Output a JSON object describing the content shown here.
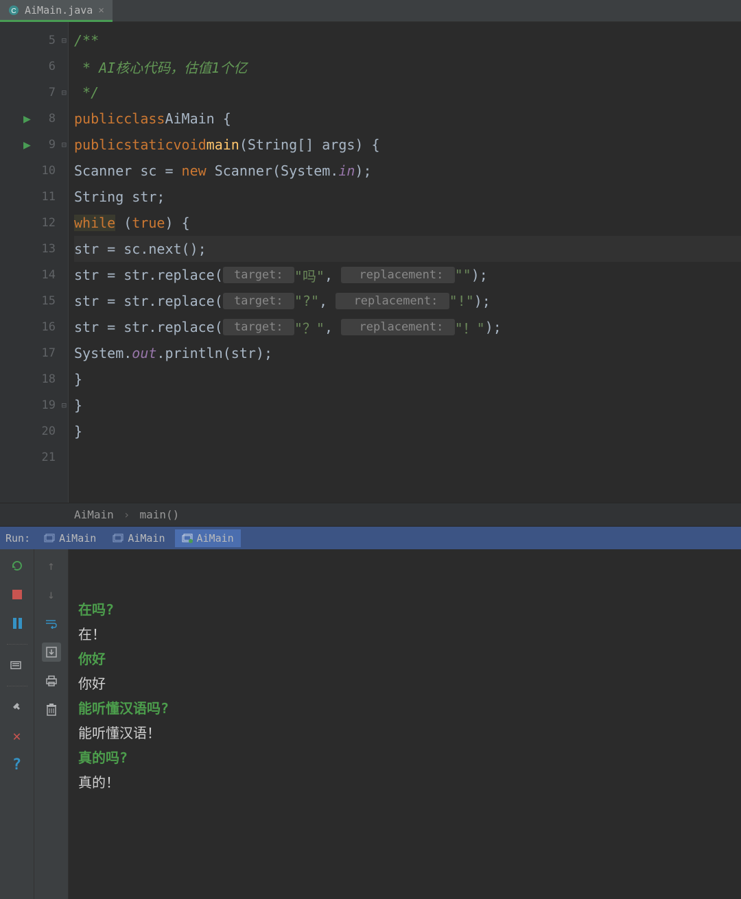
{
  "tab": {
    "filename": "AiMain.java"
  },
  "breadcrumb": {
    "class": "AiMain",
    "method": "main()"
  },
  "gutter": {
    "lines": [
      "5",
      "6",
      "7",
      "8",
      "9",
      "10",
      "11",
      "12",
      "13",
      "14",
      "15",
      "16",
      "17",
      "18",
      "19",
      "20",
      "21"
    ]
  },
  "code": {
    "comment_start": "/**",
    "comment_body": " * AI核心代码，估值1个亿",
    "comment_end": " */",
    "kw_public": "public",
    "kw_class": "class",
    "kw_static": "static",
    "kw_void": "void",
    "kw_new": "new",
    "kw_while": "while",
    "kw_true": "true",
    "classname": "AiMain",
    "method_main": "main",
    "sig_args": "(String[] args) {",
    "line10": "Scanner sc = ",
    "line10b": " Scanner(System.",
    "field_in": "in",
    "line10c": ");",
    "line11": "String str;",
    "line12_open": " (",
    "line12_close": ") {",
    "line13": "str = sc.next();",
    "replace_pre": "str = str.replace(",
    "hint_target": " target: ",
    "hint_replacement": "  replacement: ",
    "str_ma": "\"吗\"",
    "str_empty": "\"\"",
    "str_q": "\"?\"",
    "str_bang": "\"!\"",
    "str_qfull": "\"？\"",
    "str_bangfull": "\"！\"",
    "replace_mid": ", ",
    "replace_end": ");",
    "line17a": "System.",
    "field_out": "out",
    "line17b": ".println(str);",
    "brace_close": "}"
  },
  "run": {
    "label": "Run:",
    "tabs": [
      "AiMain",
      "AiMain",
      "AiMain"
    ]
  },
  "console": {
    "lines": [
      {
        "type": "input",
        "text": "在吗?"
      },
      {
        "type": "output",
        "text": "在！"
      },
      {
        "type": "input",
        "text": "你好"
      },
      {
        "type": "output",
        "text": "你好"
      },
      {
        "type": "input",
        "text": "能听懂汉语吗?"
      },
      {
        "type": "output",
        "text": "能听懂汉语！"
      },
      {
        "type": "input",
        "text": "真的吗?"
      },
      {
        "type": "output",
        "text": "真的！"
      }
    ]
  }
}
